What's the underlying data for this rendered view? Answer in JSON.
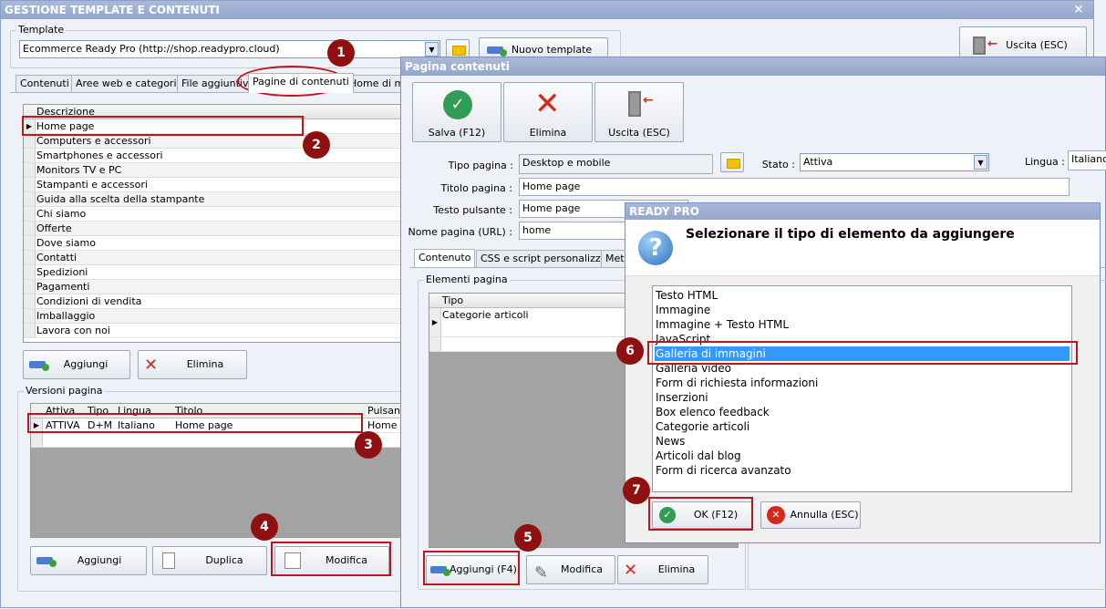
{
  "main": {
    "title": "GESTIONE TEMPLATE E CONTENUTI",
    "close": "×",
    "template_label": "Template",
    "template_value": "Ecommerce Ready Pro (http://shop.readypro.cloud)",
    "new_template": "Nuovo template",
    "exit": "Uscita (ESC)",
    "tabs": [
      "Contenuti",
      "Aree web e categorie",
      "File aggiuntivi",
      "Pagine di contenuti",
      "Home di mar"
    ],
    "pages_header": "Descrizione",
    "pages": [
      "Home page",
      "Computers e accessori",
      "Smartphones e accessori",
      "Monitors TV e PC",
      "Stampanti e accessori",
      "Guida alla scelta della stampante",
      "Chi siamo",
      "Offerte",
      "Dove siamo",
      "Contatti",
      "Spedizioni",
      "Pagamenti",
      "Condizioni di vendita",
      "Imballaggio",
      "Lavora con noi"
    ],
    "add": "Aggiungi",
    "delete": "Elimina",
    "versions_label": "Versioni pagina",
    "versions_cols": [
      "Attiva",
      "Tipo",
      "Lingua",
      "Titolo",
      "Pulsante"
    ],
    "versions_row": [
      "ATTIVA",
      "D+M",
      "Italiano",
      "Home page",
      "Home p"
    ],
    "v_add": "Aggiungi",
    "v_dup": "Duplica",
    "v_edit": "Modifica"
  },
  "page_win": {
    "title": "Pagina contenuti",
    "save": "Salva (F12)",
    "delete": "Elimina",
    "exit": "Uscita (ESC)",
    "type_label": "Tipo pagina :",
    "type_value": "Desktop e mobile",
    "state_label": "Stato :",
    "state_value": "Attiva",
    "lang_label": "Lingua :",
    "lang_value": "Italiano (",
    "title_label": "Titolo pagina :",
    "title_value": "Home page",
    "button_label": "Testo pulsante :",
    "button_value": "Home page",
    "url_label": "Nome pagina (URL) :",
    "url_value": "home",
    "tabs": [
      "Contenuto",
      "CSS e script personalizzati",
      "Meta"
    ],
    "elements_label": "Elementi pagina",
    "elements_header": "Tipo",
    "elements_row": "Categorie articoli",
    "add": "Aggiungi (F4)",
    "edit": "Modifica"
  },
  "dialog": {
    "title": "READY PRO",
    "question": "Selezionare il tipo di elemento da aggiungere",
    "items": [
      "Testo HTML",
      "Immagine",
      "Immagine + Testo HTML",
      "JavaScript",
      "Galleria di immagini",
      "Galleria video",
      "Form di richiesta informazioni",
      "Inserzioni",
      "Box elenco feedback",
      "Categorie articoli",
      "News",
      "Articoli dal blog",
      "Form di ricerca avanzato"
    ],
    "selected_index": 4,
    "ok": "OK (F12)",
    "cancel": "Annulla (ESC)"
  },
  "badges": [
    "1",
    "2",
    "3",
    "4",
    "5",
    "6",
    "7"
  ],
  "colors": {
    "highlight": "#c0141c",
    "badge": "#8e1010",
    "selection": "#3399ff"
  }
}
